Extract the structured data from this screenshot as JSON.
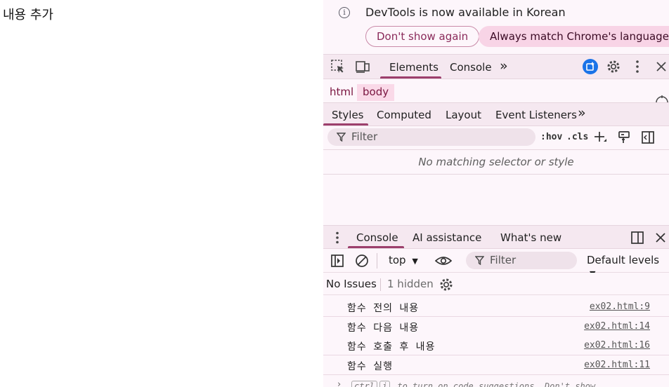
{
  "page": {
    "text": "내용 추가"
  },
  "infobar": {
    "message": "DevTools is now available in Korean",
    "dont_show": "Don't show again",
    "always_match": "Always match Chrome's language"
  },
  "toolbar": {
    "tabs": [
      {
        "label": "Elements",
        "active": true
      },
      {
        "label": "Console",
        "active": false
      }
    ],
    "more": "»"
  },
  "breadcrumb": [
    "html",
    "body"
  ],
  "styles": {
    "tabs": [
      "Styles",
      "Computed",
      "Layout",
      "Event Listeners"
    ],
    "filter_placeholder": "Filter",
    "hov": ":hov",
    "cls": ".cls",
    "empty_message": "No matching selector or style"
  },
  "drawer": {
    "tabs": [
      "Console",
      "AI assistance",
      "What's new"
    ],
    "context": "top",
    "filter_placeholder": "Filter",
    "levels": "Default levels",
    "issues": {
      "none": "No Issues",
      "hidden": "1 hidden"
    },
    "logs": [
      {
        "message": "함수 전의 내용",
        "source": "ex02.html:9"
      },
      {
        "message": "함수 다음 내용",
        "source": "ex02.html:14"
      },
      {
        "message": "함수 호출 후 내용",
        "source": "ex02.html:16"
      },
      {
        "message": "함수 실행",
        "source": "ex02.html:11"
      }
    ],
    "hint": {
      "key1": "ctrl",
      "key2": "i",
      "text": "to turn on code suggestions. Don't show"
    }
  },
  "colors": {
    "accent": "#9c3f6c",
    "panel_bg": "#fdf6fb",
    "toolbar_bg": "#f5e8f0",
    "ai_badge": "#1a73e8"
  }
}
